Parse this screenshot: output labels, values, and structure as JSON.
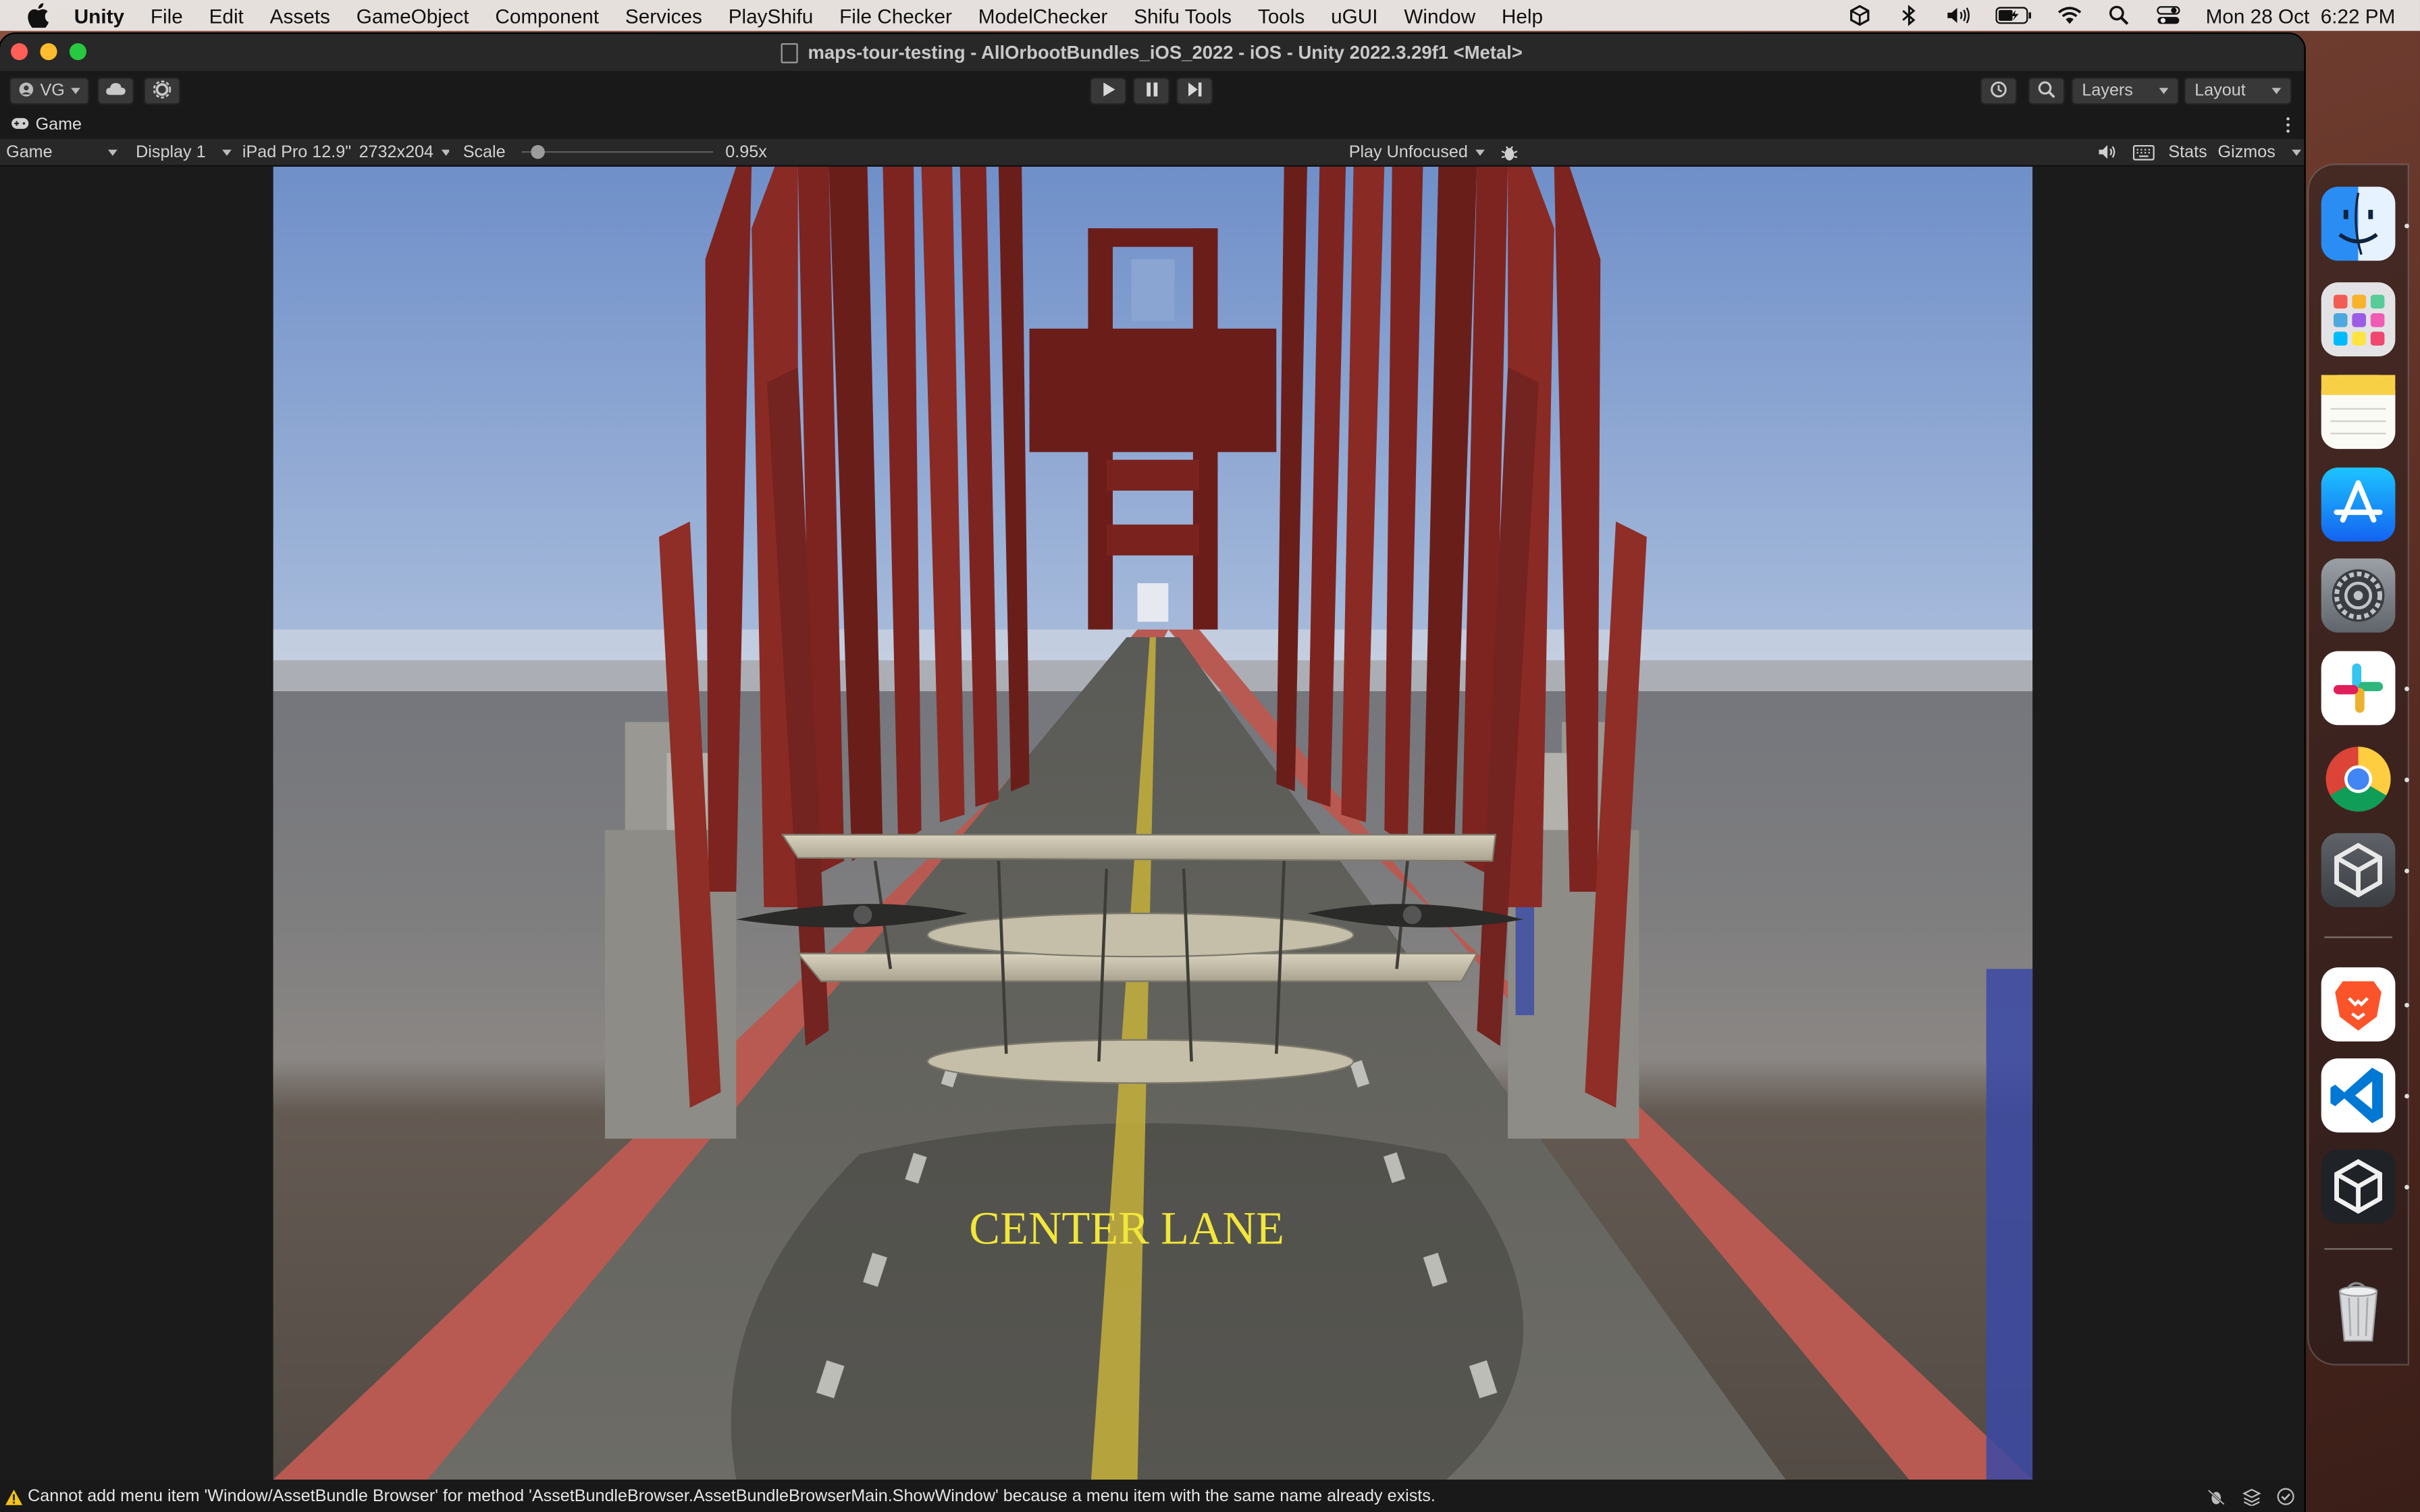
{
  "menubar": {
    "app": "Unity",
    "items": [
      "File",
      "Edit",
      "Assets",
      "GameObject",
      "Component",
      "Services",
      "PlayShifu",
      "File Checker",
      "ModelChecker",
      "Shifu Tools",
      "Tools",
      "uGUI",
      "Window",
      "Help"
    ],
    "clock": "Mon 28 Oct  6:22 PM"
  },
  "window": {
    "title": "maps-tour-testing - AllOrbootBundles_iOS_2022 - iOS - Unity 2022.3.29f1 <Metal>"
  },
  "toolbar": {
    "account": "VG",
    "layers": "Layers",
    "layout": "Layout"
  },
  "game_tab": {
    "label": "Game"
  },
  "game_bar": {
    "view_mode": "Game",
    "display": "Display 1",
    "device": "iPad Pro 12.9\"",
    "resolution": "2732x204",
    "scale_label": "Scale",
    "scale_value": "0.95x",
    "scale_fraction": 0.05,
    "play_focus": "Play Unfocused",
    "stats": "Stats",
    "gizmos": "Gizmos"
  },
  "scene": {
    "overlay_text": "CENTER LANE",
    "overlay_color": "#f2e63a"
  },
  "status": {
    "message": "Cannot add menu item 'Window/AssetBundle Browser' for method 'AssetBundleBrowser.AssetBundleBrowserMain.ShowWindow' because a menu item with the same name already exists.",
    "warning_color": "#f2c318"
  },
  "dock": {
    "apps": [
      "finder-icon",
      "launchpad-icon",
      "notes-icon",
      "app-store-icon",
      "system-settings-icon",
      "slack-icon",
      "chrome-icon",
      "unity-hub-icon",
      "brave-icon",
      "vscode-icon",
      "unity-icon",
      "trash-icon"
    ]
  }
}
